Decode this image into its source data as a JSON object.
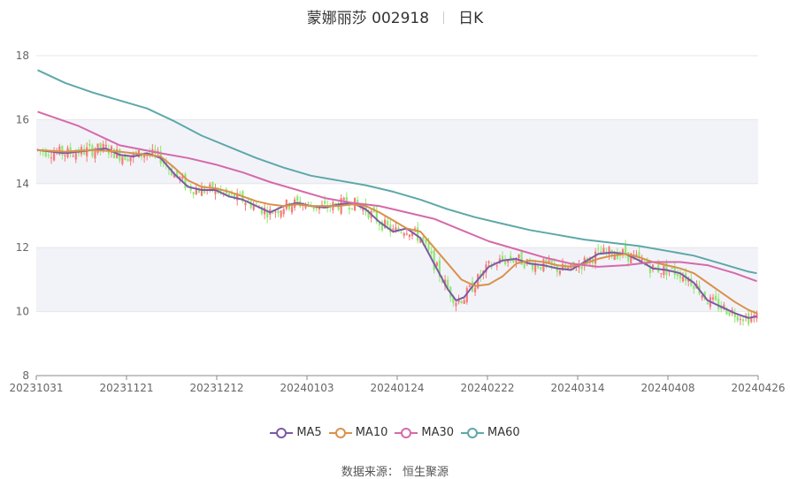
{
  "header": {
    "stock": "蒙娜丽莎 002918",
    "period": "日K"
  },
  "footer": {
    "source": "数据来源： 恒生聚源"
  },
  "colors": {
    "up": "#f47a7a",
    "down": "#8ee86e",
    "ma5": "#7b5aa6",
    "ma10": "#d9914a",
    "ma30": "#d56aaa",
    "ma60": "#5ea8a8",
    "band": "#f2f3f9",
    "grid": "#e6e6e6",
    "axis": "#666666"
  },
  "chart_data": {
    "type": "candlestick",
    "title": "蒙娜丽莎 002918 日K",
    "ylim": [
      8,
      18
    ],
    "yticks": [
      8,
      10,
      12,
      14,
      16,
      18
    ],
    "xticks": [
      "20231031",
      "20231121",
      "20231212",
      "20240103",
      "20240124",
      "20240222",
      "20240314",
      "20240408",
      "20240426"
    ],
    "legend": [
      "MA5",
      "MA10",
      "MA30",
      "MA60"
    ],
    "series": [
      {
        "name": "MA5",
        "points": [
          [
            0,
            15.05
          ],
          [
            10,
            14.95
          ],
          [
            20,
            15.05
          ],
          [
            25,
            15.1
          ],
          [
            30,
            14.9
          ],
          [
            35,
            14.85
          ],
          [
            40,
            14.95
          ],
          [
            45,
            14.8
          ],
          [
            50,
            14.3
          ],
          [
            55,
            13.9
          ],
          [
            60,
            13.8
          ],
          [
            65,
            13.8
          ],
          [
            70,
            13.6
          ],
          [
            75,
            13.5
          ],
          [
            80,
            13.3
          ],
          [
            85,
            13.1
          ],
          [
            90,
            13.3
          ],
          [
            95,
            13.4
          ],
          [
            100,
            13.3
          ],
          [
            105,
            13.25
          ],
          [
            110,
            13.35
          ],
          [
            115,
            13.4
          ],
          [
            120,
            13.2
          ],
          [
            125,
            12.8
          ],
          [
            130,
            12.5
          ],
          [
            135,
            12.6
          ],
          [
            140,
            12.3
          ],
          [
            145,
            11.5
          ],
          [
            150,
            10.7
          ],
          [
            153,
            10.35
          ],
          [
            156,
            10.45
          ],
          [
            160,
            10.9
          ],
          [
            165,
            11.4
          ],
          [
            170,
            11.6
          ],
          [
            175,
            11.65
          ],
          [
            180,
            11.5
          ],
          [
            185,
            11.45
          ],
          [
            190,
            11.35
          ],
          [
            195,
            11.3
          ],
          [
            200,
            11.55
          ],
          [
            205,
            11.8
          ],
          [
            210,
            11.85
          ],
          [
            215,
            11.8
          ],
          [
            220,
            11.6
          ],
          [
            225,
            11.35
          ],
          [
            230,
            11.3
          ],
          [
            235,
            11.2
          ],
          [
            240,
            10.9
          ],
          [
            245,
            10.35
          ],
          [
            250,
            10.15
          ],
          [
            255,
            9.95
          ],
          [
            260,
            9.8
          ],
          [
            263,
            9.85
          ]
        ]
      },
      {
        "name": "MA10",
        "points": [
          [
            0,
            15.05
          ],
          [
            10,
            15.0
          ],
          [
            20,
            15.05
          ],
          [
            30,
            15.0
          ],
          [
            40,
            14.9
          ],
          [
            45,
            14.85
          ],
          [
            50,
            14.5
          ],
          [
            55,
            14.1
          ],
          [
            60,
            13.9
          ],
          [
            65,
            13.85
          ],
          [
            70,
            13.75
          ],
          [
            75,
            13.6
          ],
          [
            80,
            13.45
          ],
          [
            85,
            13.35
          ],
          [
            90,
            13.3
          ],
          [
            95,
            13.35
          ],
          [
            100,
            13.3
          ],
          [
            105,
            13.3
          ],
          [
            110,
            13.3
          ],
          [
            115,
            13.35
          ],
          [
            120,
            13.3
          ],
          [
            125,
            13.1
          ],
          [
            130,
            12.85
          ],
          [
            135,
            12.6
          ],
          [
            140,
            12.5
          ],
          [
            145,
            12.0
          ],
          [
            150,
            11.5
          ],
          [
            155,
            11.0
          ],
          [
            160,
            10.8
          ],
          [
            165,
            10.85
          ],
          [
            170,
            11.1
          ],
          [
            175,
            11.5
          ],
          [
            180,
            11.6
          ],
          [
            185,
            11.55
          ],
          [
            190,
            11.45
          ],
          [
            195,
            11.4
          ],
          [
            200,
            11.5
          ],
          [
            205,
            11.65
          ],
          [
            210,
            11.75
          ],
          [
            215,
            11.8
          ],
          [
            220,
            11.7
          ],
          [
            225,
            11.55
          ],
          [
            230,
            11.45
          ],
          [
            235,
            11.35
          ],
          [
            240,
            11.2
          ],
          [
            245,
            10.9
          ],
          [
            250,
            10.6
          ],
          [
            255,
            10.3
          ],
          [
            260,
            10.05
          ],
          [
            263,
            9.95
          ]
        ]
      },
      {
        "name": "MA30",
        "points": [
          [
            0,
            16.25
          ],
          [
            15,
            15.8
          ],
          [
            30,
            15.2
          ],
          [
            45,
            14.95
          ],
          [
            55,
            14.8
          ],
          [
            65,
            14.6
          ],
          [
            75,
            14.35
          ],
          [
            85,
            14.05
          ],
          [
            95,
            13.8
          ],
          [
            105,
            13.55
          ],
          [
            115,
            13.4
          ],
          [
            125,
            13.3
          ],
          [
            135,
            13.1
          ],
          [
            145,
            12.9
          ],
          [
            155,
            12.55
          ],
          [
            165,
            12.2
          ],
          [
            175,
            11.95
          ],
          [
            185,
            11.7
          ],
          [
            195,
            11.5
          ],
          [
            205,
            11.4
          ],
          [
            215,
            11.45
          ],
          [
            225,
            11.55
          ],
          [
            235,
            11.55
          ],
          [
            245,
            11.45
          ],
          [
            255,
            11.2
          ],
          [
            263,
            10.95
          ]
        ]
      },
      {
        "name": "MA60",
        "points": [
          [
            0,
            17.55
          ],
          [
            10,
            17.15
          ],
          [
            20,
            16.85
          ],
          [
            30,
            16.6
          ],
          [
            40,
            16.35
          ],
          [
            50,
            15.95
          ],
          [
            60,
            15.5
          ],
          [
            70,
            15.15
          ],
          [
            80,
            14.8
          ],
          [
            90,
            14.5
          ],
          [
            100,
            14.25
          ],
          [
            110,
            14.1
          ],
          [
            120,
            13.95
          ],
          [
            130,
            13.75
          ],
          [
            140,
            13.5
          ],
          [
            150,
            13.2
          ],
          [
            160,
            12.95
          ],
          [
            170,
            12.75
          ],
          [
            180,
            12.55
          ],
          [
            190,
            12.4
          ],
          [
            200,
            12.25
          ],
          [
            210,
            12.15
          ],
          [
            220,
            12.05
          ],
          [
            230,
            11.9
          ],
          [
            240,
            11.75
          ],
          [
            250,
            11.5
          ],
          [
            260,
            11.25
          ],
          [
            263,
            11.2
          ]
        ]
      }
    ]
  }
}
